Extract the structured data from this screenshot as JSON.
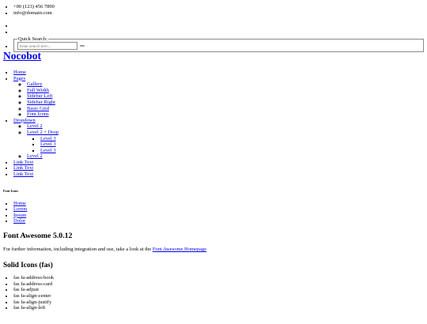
{
  "topbar": {
    "phone": "+00 (123) 456 7890",
    "email": "info@domain.com"
  },
  "search": {
    "legend": "Quick Search:",
    "placeholder": "Enter search term..."
  },
  "logo": {
    "text": "Nocobot"
  },
  "nav": {
    "home": "Home",
    "pages": {
      "label": "Pages",
      "items": [
        "Gallery",
        "Full Width",
        "Sidebar Left",
        "Sidebar Right",
        "Basic Grid",
        "Font Icons"
      ]
    },
    "dropdown": {
      "label": "Dropdown",
      "level2_a": "Level 2",
      "level2_drop": "Level 2 + Drop",
      "level3": [
        "Level 3",
        "Level 3",
        "Level 3"
      ],
      "level2_b": "Level 2"
    },
    "links": [
      "Link Text",
      "Link Text",
      "Link Text"
    ]
  },
  "page_title": "Font Icons",
  "breadcrumb": [
    "Home",
    "Lorem",
    "Ipsum",
    "Dolor"
  ],
  "content": {
    "heading": "Font Awesome 5.0.12",
    "info_text": "For further information, including integration and use, take a look at the ",
    "info_link": "Font Awesome Homepage",
    "solid_heading": "Solid Icons (fas)",
    "icons": [
      "fas fa-address-book",
      "fas fa-address-card",
      "fas fa-adjust",
      "fas fa-align-center",
      "fas fa-align-justify",
      "fas fa-align-left"
    ]
  }
}
